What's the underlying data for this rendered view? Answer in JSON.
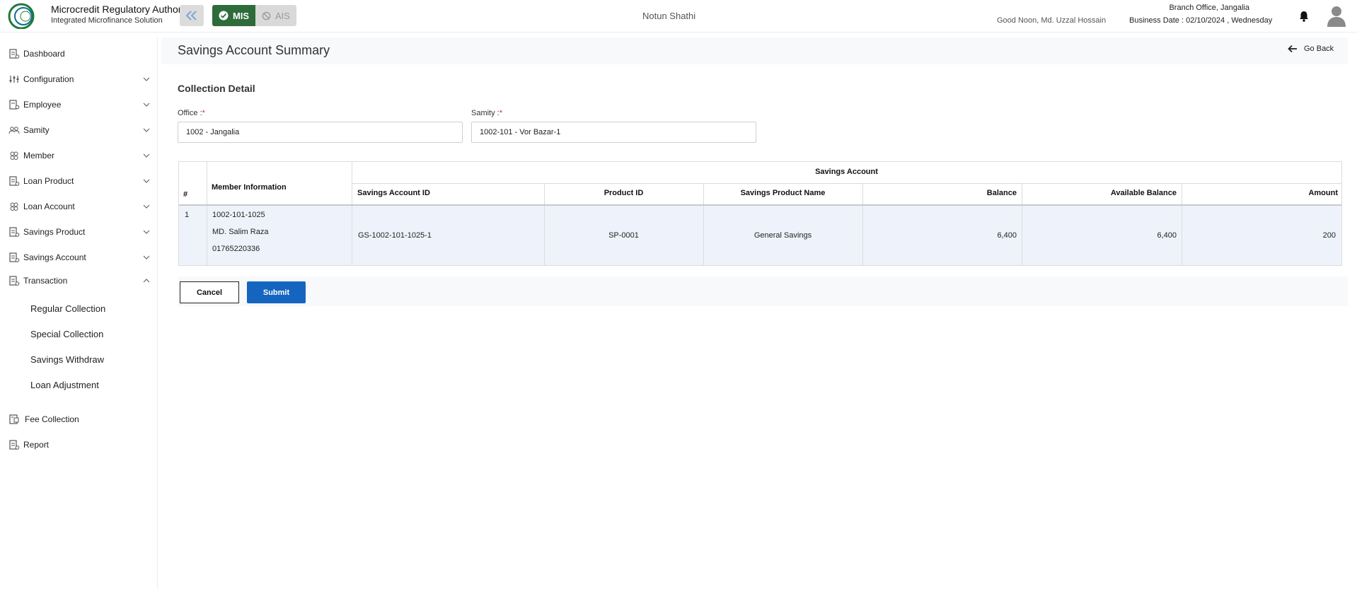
{
  "header": {
    "logo_text": "Microcredit Regulatory Authority",
    "brand_title": "Microcredit Regulatory Authority",
    "brand_subtitle": "Integrated Microfinance Solution",
    "mis_label": "MIS",
    "ais_label": "AIS",
    "center_title": "Notun Shathi",
    "greeting": "Good Noon, Md. Uzzal Hossain",
    "branch": "Branch Office, Jangalia",
    "business_date": "Business Date : 02/10/2024 , Wednesday",
    "colors": {
      "mis_bg": "#2e6b3b",
      "ais_bg": "#d9d9d9",
      "logo_green": "#1f7a3c",
      "logo_teal": "#0e6f8a"
    }
  },
  "sidebar": {
    "items": [
      {
        "label": "Dashboard",
        "icon": "dashboard-icon"
      },
      {
        "label": "Configuration",
        "icon": "sliders-icon"
      },
      {
        "label": "Employee",
        "icon": "employee-icon"
      },
      {
        "label": "Samity",
        "icon": "group-icon"
      },
      {
        "label": "Member",
        "icon": "member-icon"
      },
      {
        "label": "Loan Product",
        "icon": "document-icon"
      },
      {
        "label": "Loan Account",
        "icon": "account-icon"
      },
      {
        "label": "Savings Product",
        "icon": "document-icon"
      },
      {
        "label": "Savings Account",
        "icon": "document-icon"
      },
      {
        "label": "Transaction",
        "icon": "document-icon"
      },
      {
        "label": "Fee Collection",
        "icon": "fee-icon"
      },
      {
        "label": "Report",
        "icon": "report-icon"
      }
    ],
    "transaction_subitems": [
      {
        "label": "Regular Collection"
      },
      {
        "label": "Special Collection"
      },
      {
        "label": "Savings Withdraw"
      },
      {
        "label": "Loan Adjustment"
      }
    ]
  },
  "page": {
    "title": "Savings Account Summary",
    "go_back": "Go Back",
    "section_title": "Collection Detail",
    "office_label": "Office :",
    "office_value": "1002 - Jangalia",
    "samity_label": "Samity :",
    "samity_value": "1002-101 - Vor Bazar-1",
    "required_mark": "*"
  },
  "table": {
    "group_header": "Savings Account",
    "headers": {
      "index": "#",
      "member": "Member Information",
      "account_id": "Savings Account ID",
      "product_id": "Product ID",
      "product_name": "Savings Product Name",
      "balance": "Balance",
      "available_balance": "Available Balance",
      "amount": "Amount"
    },
    "rows": [
      {
        "index": "1",
        "member_id": "1002-101-1025",
        "member_name": "MD. Salim Raza",
        "member_phone": "01765220336",
        "account_id": "GS-1002-101-1025-1",
        "product_id": "SP-0001",
        "product_name": "General Savings",
        "balance": "6,400",
        "available_balance": "6,400",
        "amount": "200"
      }
    ]
  },
  "actions": {
    "cancel": "Cancel",
    "submit": "Submit",
    "submit_color": "#1565c0"
  }
}
